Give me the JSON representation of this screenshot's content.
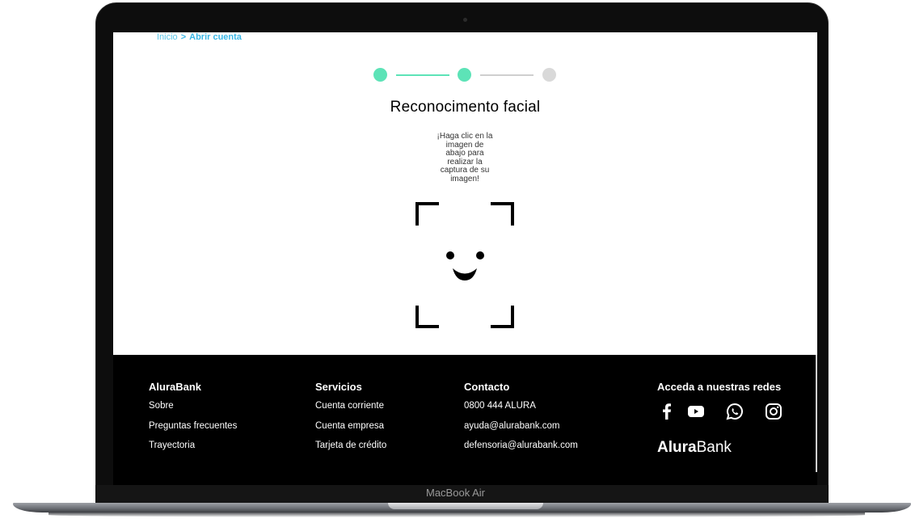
{
  "device": {
    "model_label": "MacBook Air"
  },
  "breadcrumb": {
    "home": "Inicio",
    "separator": ">",
    "current": "Abrir cuenta"
  },
  "stepper": {
    "total_steps": 3,
    "completed_steps": 2,
    "colors": {
      "done": "#5de3b7",
      "todo": "#d9d9d9"
    }
  },
  "main": {
    "title": "Reconocimento facial",
    "instruction_lines": [
      "¡Haga clic en la",
      "imagen de",
      "abajo para",
      "realizar la",
      "captura de su",
      "imagen!"
    ],
    "capture_icon": "face-scan-icon"
  },
  "footer": {
    "col1": {
      "heading": "AluraBank",
      "links": [
        "Sobre",
        "Preguntas frecuentes",
        "Trayectoria"
      ]
    },
    "col2": {
      "heading": "Servicios",
      "links": [
        "Cuenta corriente",
        "Cuenta empresa",
        "Tarjeta de crédito"
      ]
    },
    "col3": {
      "heading": "Contacto",
      "links": [
        "0800 444 ALURA",
        "ayuda@alurabank.com",
        "defensoria@alurabank.com"
      ]
    },
    "col4": {
      "heading": "Acceda a nuestras redes",
      "social_icons": [
        "facebook-icon",
        "youtube-icon",
        "whatsapp-icon",
        "instagram-icon"
      ]
    },
    "brand": {
      "bold": "Alura",
      "regular": "Bank"
    }
  }
}
